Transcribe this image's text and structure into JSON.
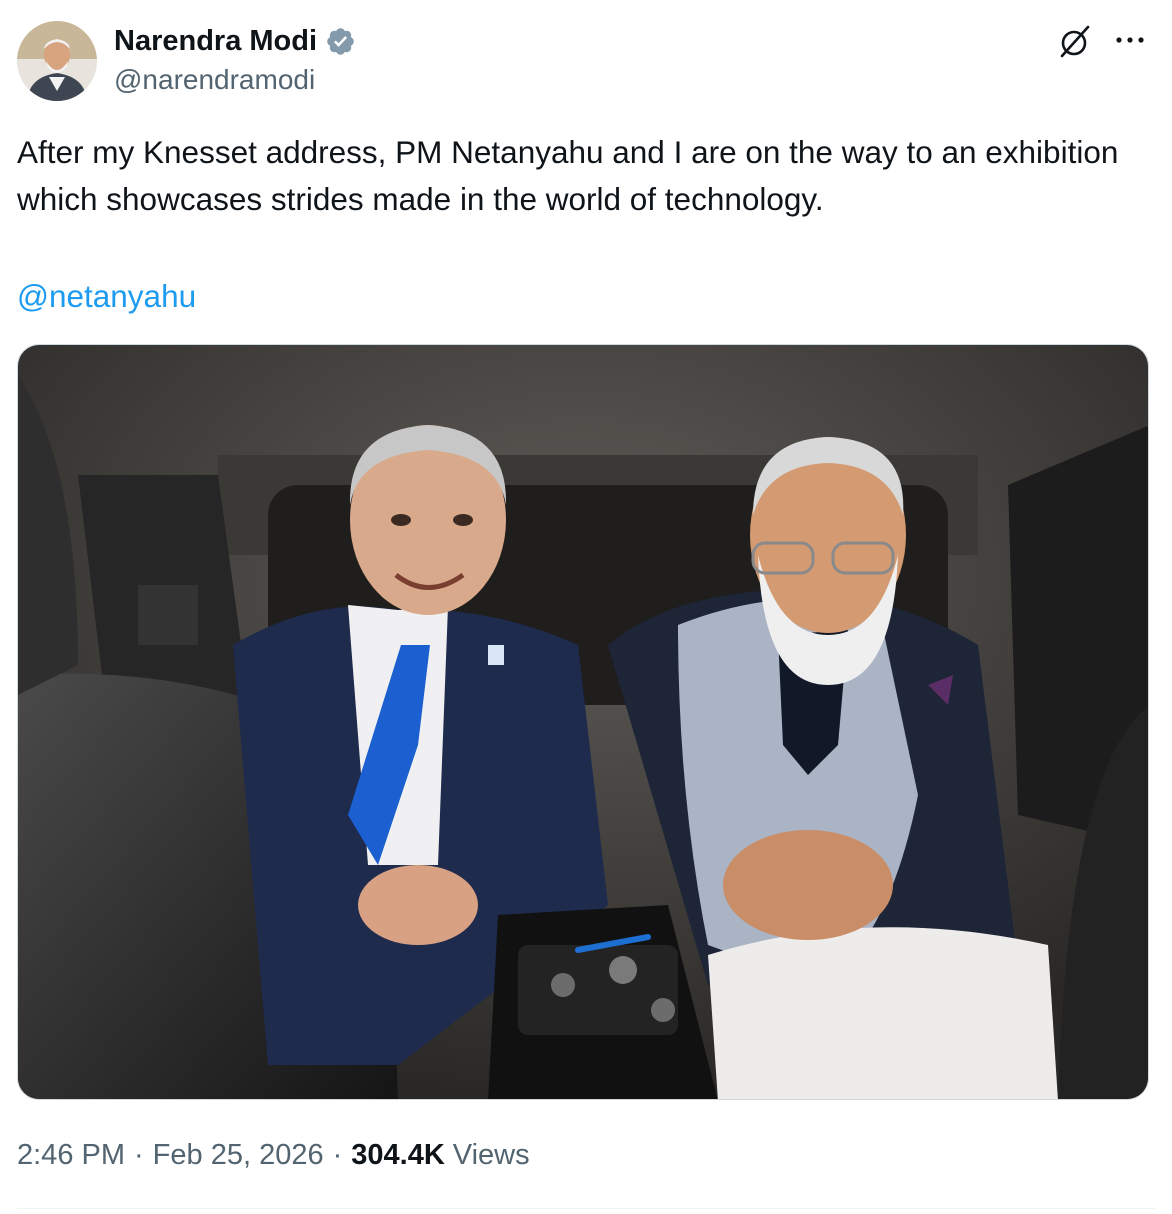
{
  "author": {
    "display_name": "Narendra Modi",
    "handle": "@narendramodi",
    "verified": true,
    "avatar_icon": "profile-photo"
  },
  "tweet": {
    "text": "After my Knesset address, PM Netanyahu and I are on the way to an exhibition which showcases strides made in the world of technology.",
    "mention": "@netanyahu"
  },
  "meta": {
    "time": "2:46 PM",
    "separator": "·",
    "date": "Feb 25, 2026",
    "views_count": "304.4K",
    "views_label": "Views"
  },
  "icons": {
    "grok": "grok-icon",
    "more": "more-icon",
    "verified": "verified-badge-icon"
  },
  "colors": {
    "text": "#0f1419",
    "secondary": "#536471",
    "link": "#1d9bf0",
    "verified": "#829aab"
  }
}
